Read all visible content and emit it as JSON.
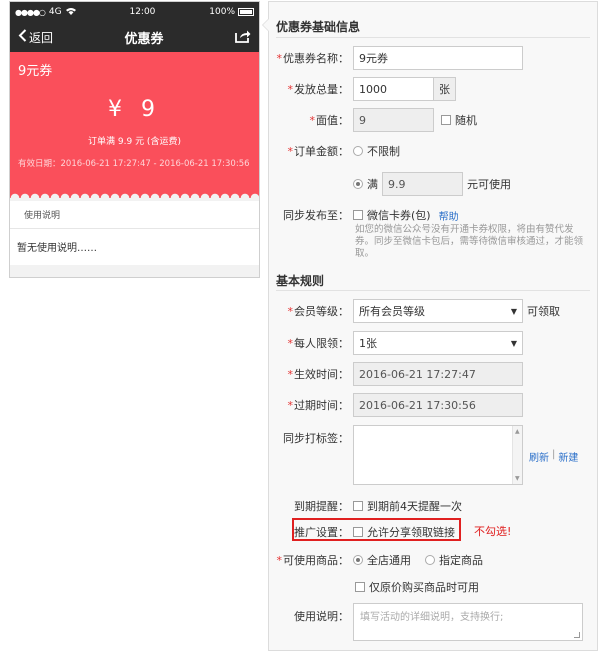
{
  "phone": {
    "status": {
      "carrier": "4G",
      "time": "12:00",
      "battery": "100%"
    },
    "nav": {
      "back": "返回",
      "title": "优惠券"
    },
    "coupon": {
      "name": "9元券",
      "value": "¥ 9",
      "limit": "订单满 9.9 元 (含运费)",
      "validity": "有效日期：2016-06-21 17:27:47 - 2016-06-21 17:30:56"
    },
    "usage": {
      "title": "使用说明",
      "body": "暂无使用说明……"
    }
  },
  "form": {
    "section_basic": "优惠券基础信息",
    "name": {
      "label": "优惠券名称：",
      "value": "9元券"
    },
    "total": {
      "label": "发放总量：",
      "value": "1000",
      "unit": "张"
    },
    "face": {
      "label": "面值：",
      "value": "9",
      "random": "随机"
    },
    "amount": {
      "label": "订单金额：",
      "unlimited": "不限制",
      "full_prefix": "满",
      "full_value": "9.9",
      "full_suffix": "元可使用"
    },
    "sync": {
      "label": "同步发布至：",
      "option": "微信卡券(包)",
      "help_link": "帮助",
      "help_text": "如您的微信公众号没有开通卡券权限，将由有赞代发券。同步至微信卡包后，需等待微信审核通过，才能领取。"
    },
    "section_rules": "基本规则",
    "level": {
      "label": "会员等级：",
      "value": "所有会员等级",
      "suffix": "可领取"
    },
    "per_limit": {
      "label": "每人限领：",
      "value": "1张"
    },
    "start": {
      "label": "生效时间：",
      "value": "2016-06-21 17:27:47"
    },
    "end": {
      "label": "过期时间：",
      "value": "2016-06-21 17:30:56"
    },
    "tags": {
      "label": "同步打标签：",
      "refresh": "刷新",
      "sep": "|",
      "new": "新建"
    },
    "remind": {
      "label": "到期提醒：",
      "option": "到期前4天提醒一次"
    },
    "promo": {
      "label": "推广设置：",
      "option": "允许分享领取链接",
      "warning": "不勾选!"
    },
    "goods": {
      "label": "可使用商品：",
      "all": "全店通用",
      "specified": "指定商品",
      "original_only": "仅原价购买商品时可用"
    },
    "desc": {
      "label": "使用说明：",
      "placeholder": "填写活动的详细说明，支持换行;"
    }
  },
  "colors": {
    "coupon_red": "#fa4f5b",
    "required_red": "#e53333",
    "link_blue": "#2a6fc9"
  }
}
